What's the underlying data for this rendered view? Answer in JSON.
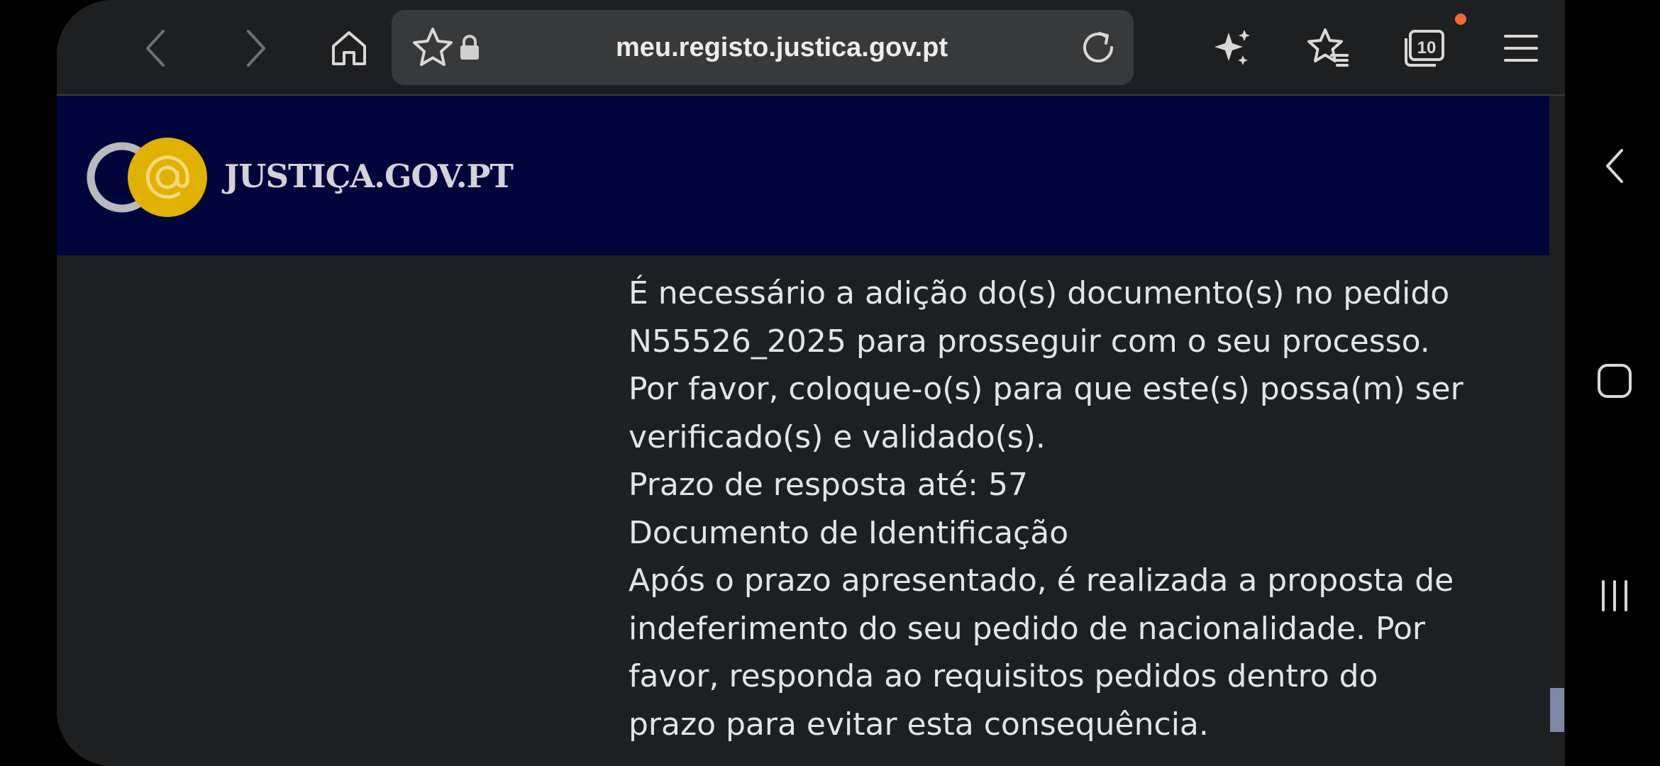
{
  "browser": {
    "url": "meu.registo.justica.gov.pt",
    "tab_count": "10",
    "icons": {
      "back": "chevron-left-icon",
      "forward": "chevron-right-icon",
      "home": "home-icon",
      "bookmark": "star-icon",
      "lock": "lock-icon",
      "reload": "reload-icon",
      "ai": "sparkle-icon",
      "bookmarks": "bookmarks-list-icon",
      "tabs": "tabs-icon",
      "menu": "hamburger-menu-icon"
    },
    "notification_color": "#ee6a2f"
  },
  "site": {
    "brand": "JUSTIÇA.GOV.PT",
    "header_color": "#00063c",
    "logo_accent": "#e0b100"
  },
  "message": {
    "lines": [
      "É necessário a adição do(s) documento(s) no pedido N55526_2025 para prosseguir com o seu processo.",
      "Por favor, coloque-o(s) para que este(s) possa(m) ser verificado(s) e validado(s).",
      "Prazo de resposta até: 57",
      "Documento de  Identificação",
      "Após o prazo apresentado, é realizada a proposta de indeferimento do seu pedido de nacionalidade. Por favor, responda ao requisitos pedidos dentro do prazo para evitar esta consequência."
    ]
  },
  "system_nav": {
    "back": "chevron-left-icon",
    "home": "home-square-icon",
    "recents": "recents-icon"
  }
}
